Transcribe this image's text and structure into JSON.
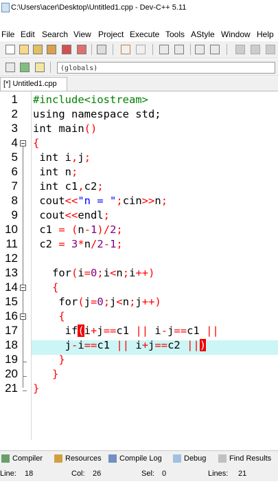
{
  "window": {
    "title": "C:\\Users\\acer\\Desktop\\Untitled1.cpp - Dev-C++ 5.11"
  },
  "menu": [
    "File",
    "Edit",
    "Search",
    "View",
    "Project",
    "Execute",
    "Tools",
    "AStyle",
    "Window",
    "Help"
  ],
  "toolbar_scope": "(globals)",
  "tab": {
    "label": "[*] Untitled1.cpp"
  },
  "editor": {
    "lines": [
      {
        "n": "1"
      },
      {
        "n": "2"
      },
      {
        "n": "3"
      },
      {
        "n": "4"
      },
      {
        "n": "5"
      },
      {
        "n": "6"
      },
      {
        "n": "7"
      },
      {
        "n": "8"
      },
      {
        "n": "9"
      },
      {
        "n": "10"
      },
      {
        "n": "11"
      },
      {
        "n": "12"
      },
      {
        "n": "13"
      },
      {
        "n": "14"
      },
      {
        "n": "15"
      },
      {
        "n": "16"
      },
      {
        "n": "17"
      },
      {
        "n": "18"
      },
      {
        "n": "19"
      },
      {
        "n": "20"
      },
      {
        "n": "21"
      }
    ],
    "code": {
      "l1": "#include<iostream>",
      "l2": "using namespace std;",
      "l3a": "int main",
      "l3b": "()",
      "l4": "{",
      "l5a": " int i",
      "l5b": ",",
      "l5c": "j",
      "l5d": ";",
      "l6a": " int n",
      "l6b": ";",
      "l7a": " int c1",
      "l7b": ",",
      "l7c": "c2",
      "l7d": ";",
      "l8a": " cout",
      "l8b": "<<",
      "l8c": "\"n = \"",
      "l8d": ";",
      "l8e": "cin",
      "l8f": ">>",
      "l8g": "n",
      "l8h": ";",
      "l9a": " cout",
      "l9b": "<<",
      "l9c": "endl",
      "l9d": ";",
      "l10a": " c1 ",
      "l10b": "=",
      "l10c": " ",
      "l10d": "(",
      "l10e": "n",
      "l10f": "-",
      "l10g": "1",
      "l10h": ")/",
      "l10i": "2",
      "l10j": ";",
      "l11a": " c2 ",
      "l11b": "=",
      "l11c": " ",
      "l11d": "3",
      "l11e": "*",
      "l11f": "n",
      "l11g": "/",
      "l11h": "2",
      "l11i": "-",
      "l11j": "1",
      "l11k": ";",
      "l12": "",
      "l13a": "   for",
      "l13b": "(",
      "l13c": "i",
      "l13d": "=",
      "l13e": "0",
      "l13f": ";",
      "l13g": "i",
      "l13h": "<",
      "l13i": "n",
      "l13j": ";",
      "l13k": "i",
      "l13l": "++",
      "l13m": ")",
      "l14": "   {",
      "l15a": "    for",
      "l15b": "(",
      "l15c": "j",
      "l15d": "=",
      "l15e": "0",
      "l15f": ";",
      "l15g": "j",
      "l15h": "<",
      "l15i": "n",
      "l15j": ";",
      "l15k": "j",
      "l15l": "++",
      "l15m": ")",
      "l16": "    {",
      "l17a": "     if",
      "l17b": "(",
      "l17c": "i",
      "l17d": "+",
      "l17e": "j",
      "l17f": "==",
      "l17g": "c1 ",
      "l17h": "||",
      "l17i": " i",
      "l17j": "-",
      "l17k": "j",
      "l17l": "==",
      "l17m": "c1 ",
      "l17n": "||",
      "l18a": "     j",
      "l18b": "-",
      "l18c": "i",
      "l18d": "==",
      "l18e": "c1 ",
      "l18f": "||",
      "l18g": " i",
      "l18h": "+",
      "l18i": "j",
      "l18j": "==",
      "l18k": "c2 ",
      "l18l": "||",
      "l18m": ")",
      "l19": "    }",
      "l20": "   }",
      "l21": "}"
    }
  },
  "bottom_tabs": [
    "Compiler",
    "Resources",
    "Compile Log",
    "Debug",
    "Find Results"
  ],
  "status": {
    "line_label": "Line:",
    "line_val": "18",
    "col_label": "Col:",
    "col_val": "26",
    "sel_label": "Sel:",
    "sel_val": "0",
    "lines_label": "Lines:",
    "lines_val": "21"
  },
  "colors": {
    "highlight": "#ccf5f5",
    "operator": "#ff0000",
    "number": "#800080",
    "string": "#0000ff",
    "preprocessor": "#008000"
  }
}
